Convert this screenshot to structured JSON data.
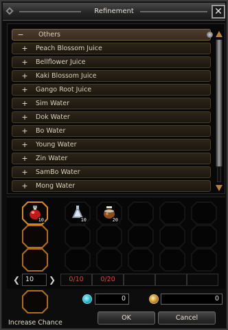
{
  "window": {
    "title": "Refinement",
    "close_glyph": "✕"
  },
  "recipe_list": {
    "category": {
      "toggle": "−",
      "label": "Others"
    },
    "items": [
      {
        "toggle": "+",
        "label": "Peach Blossom Juice"
      },
      {
        "toggle": "+",
        "label": "Bellflower Juice"
      },
      {
        "toggle": "+",
        "label": "Kaki Blossom Juice"
      },
      {
        "toggle": "+",
        "label": "Gango Root Juice"
      },
      {
        "toggle": "+",
        "label": "Sim Water"
      },
      {
        "toggle": "+",
        "label": "Dok Water"
      },
      {
        "toggle": "+",
        "label": "Bo Water"
      },
      {
        "toggle": "+",
        "label": "Young Water"
      },
      {
        "toggle": "+",
        "label": "Zin Water"
      },
      {
        "toggle": "+",
        "label": "SamBo Water"
      },
      {
        "toggle": "+",
        "label": "Mong Water"
      }
    ]
  },
  "slots": {
    "result": {
      "icon": "red-potion-icon",
      "count": "10"
    },
    "ingredients": [
      {
        "icon": "silver-flask-icon",
        "count": "10"
      },
      {
        "icon": "brown-jar-icon",
        "count": "20"
      }
    ]
  },
  "quantity": {
    "left_arrow": "❮",
    "right_arrow": "❯",
    "value": "10",
    "requirements": [
      "0/10",
      "0/20"
    ]
  },
  "bottom": {
    "chance_label": "Increase Chance",
    "gem_value": "0",
    "gold_value": "0",
    "ok_label": "OK",
    "cancel_label": "Cancel"
  },
  "colors": {
    "requirement_text": "#d04a3a",
    "slot_highlight": "#b06d1f",
    "category_row": "#4e3d2d"
  }
}
